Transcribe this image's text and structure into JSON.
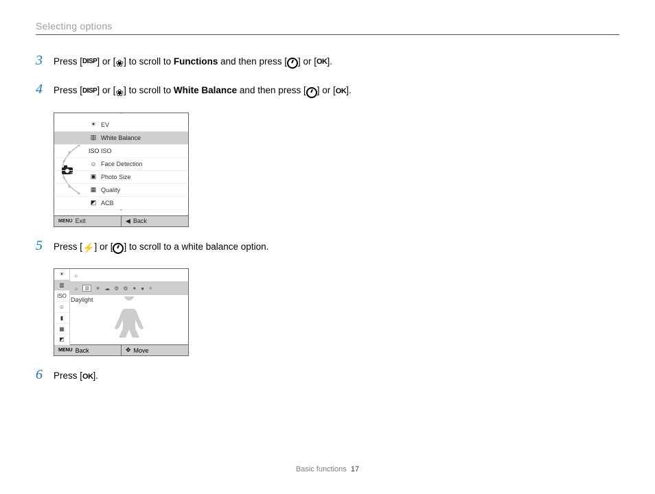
{
  "header": {
    "section_title": "Selecting options"
  },
  "steps": {
    "s3": {
      "num": "3",
      "prefix": "Press [",
      "disp": "DISP",
      "mid1": "] or [",
      "macro": "❀",
      "mid2": "] to scroll to ",
      "bold": "Functions",
      "mid3": " and then press [",
      "mid4": "] or [",
      "ok": "OK",
      "suffix": "]."
    },
    "s4": {
      "num": "4",
      "prefix": "Press [",
      "disp": "DISP",
      "mid1": "] or [",
      "macro": "❀",
      "mid2": "] to scroll to ",
      "bold": "White Balance",
      "mid3": " and then press [",
      "mid4": "] or [",
      "ok": "OK",
      "suffix": "]."
    },
    "s5": {
      "num": "5",
      "prefix": "Press [",
      "flash": "⚡",
      "mid1": "] or [",
      "mid2": "] to scroll to a white balance option."
    },
    "s6": {
      "num": "6",
      "prefix": "Press [",
      "ok": "OK",
      "suffix": "]."
    }
  },
  "menu1": {
    "items": [
      {
        "icon": "☀",
        "label": "EV",
        "sel": false
      },
      {
        "icon": "▥",
        "label": "White Balance",
        "sel": true
      },
      {
        "icon": "ISO",
        "label": "ISO",
        "sel": false
      },
      {
        "icon": "☺",
        "label": "Face Detection",
        "sel": false
      },
      {
        "icon": "▣",
        "label": "Photo Size",
        "sel": false
      },
      {
        "icon": "▦",
        "label": "Quality",
        "sel": false
      },
      {
        "icon": "◩",
        "label": "ACB",
        "sel": false
      }
    ],
    "mode_icon": "camera-dial",
    "footer_left_icon": "MENU",
    "footer_left": "Exit",
    "footer_right_icon": "◀",
    "footer_right": "Back"
  },
  "menu2": {
    "left_icons": [
      "☀",
      "▥",
      "ISO",
      "☺",
      "▮",
      "▦",
      "◩"
    ],
    "left_selected_index": 1,
    "strip_icons": [
      "☼",
      "▥",
      "☀",
      "☁",
      "⚙",
      "⚙",
      "✦",
      "●",
      "✧"
    ],
    "selected_label": "Daylight",
    "footer_left_icon": "MENU",
    "footer_left": "Back",
    "footer_right_icon": "✥",
    "footer_right": "Move"
  },
  "footer": {
    "section": "Basic functions",
    "page": "17"
  }
}
